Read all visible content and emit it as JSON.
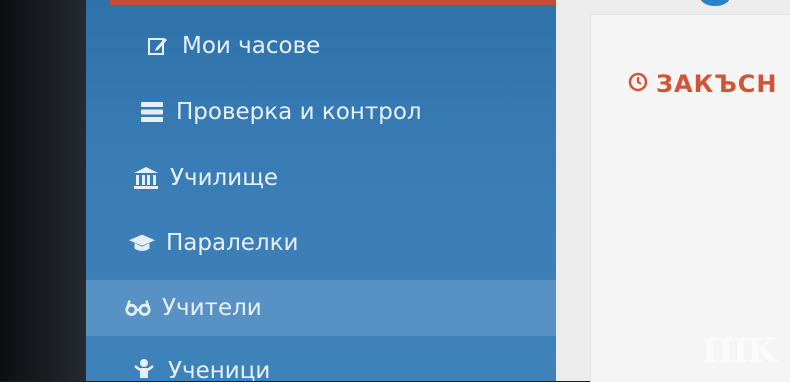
{
  "sidebar": {
    "items": [
      {
        "label": "Мои часове",
        "icon": "edit-icon"
      },
      {
        "label": "Проверка и контрол",
        "icon": "server-icon"
      },
      {
        "label": "Училище",
        "icon": "institution-icon"
      },
      {
        "label": "Паралелки",
        "icon": "graduation-cap-icon"
      },
      {
        "label": "Учители",
        "icon": "glasses-icon"
      },
      {
        "label": "Ученици",
        "icon": "child-icon"
      }
    ],
    "active_index": 4
  },
  "main": {
    "panel_title": "ЗАКЪСН"
  },
  "watermark": "ПIK",
  "colors": {
    "sidebar_bg": "#3a7db6",
    "sidebar_active": "#5891c4",
    "sidebar_text": "#e8f1fa",
    "title_accent": "#d25437",
    "top_strip": "#c94a3a"
  }
}
